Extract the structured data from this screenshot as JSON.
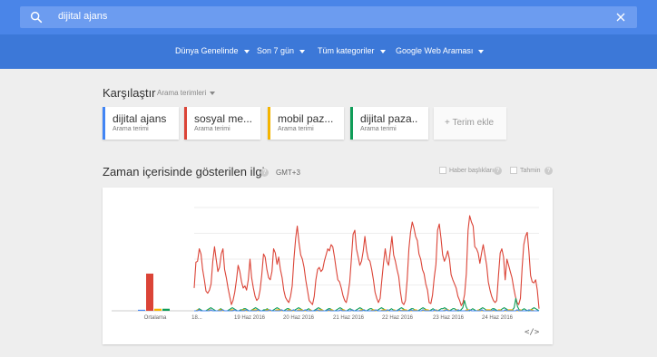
{
  "search": {
    "query": "dijital ajans"
  },
  "filters": [
    {
      "label": "Dünya Genelinde"
    },
    {
      "label": "Son 7 gün"
    },
    {
      "label": "Tüm kategoriler"
    },
    {
      "label": "Google Web Araması"
    }
  ],
  "compare": {
    "title": "Karşılaştır",
    "subtitle": "Arama terimleri",
    "terms": [
      {
        "name": "dijital ajans",
        "type": "Arama terimi",
        "color": "#4285f4"
      },
      {
        "name": "sosyal me...",
        "type": "Arama terimi",
        "color": "#db4437"
      },
      {
        "name": "mobil paz...",
        "type": "Arama terimi",
        "color": "#f4b400"
      },
      {
        "name": "dijital paza..",
        "type": "Arama terimi",
        "color": "#0f9d58"
      }
    ],
    "add_label": "+ Terim ekle"
  },
  "section": {
    "title": "Zaman içerisinde gösterilen ilgi",
    "timezone": "GMT+3",
    "news_label": "Haber başlıkları",
    "forecast_label": "Tahmin"
  },
  "chart_data": {
    "type": "line",
    "average_label": "Ortalama",
    "average_bars": [
      {
        "name": "dijital ajans",
        "value": 1
      },
      {
        "name": "sosyal medya",
        "value": 36
      },
      {
        "name": "mobil pazarlama",
        "value": 2
      },
      {
        "name": "dijital pazarlama",
        "value": 2
      }
    ],
    "x_ticks": [
      "18...",
      "19 Haz 2016",
      "20 Haz 2016",
      "21 Haz 2016",
      "22 Haz 2016",
      "23 Haz 2016",
      "24 Haz 2016"
    ],
    "ylim": [
      0,
      100
    ],
    "series": [
      {
        "name": "sosyal medya",
        "color": "#db4437",
        "values": [
          22,
          47,
          48,
          60,
          55,
          40,
          30,
          19,
          17,
          20,
          26,
          48,
          62,
          50,
          38,
          42,
          55,
          60,
          40,
          32,
          22,
          14,
          6,
          10,
          18,
          30,
          44,
          38,
          28,
          22,
          24,
          20,
          30,
          50,
          32,
          22,
          14,
          10,
          12,
          20,
          35,
          55,
          52,
          40,
          32,
          30,
          38,
          60,
          56,
          45,
          52,
          40,
          32,
          20,
          13,
          10,
          8,
          14,
          24,
          50,
          70,
          82,
          66,
          54,
          50,
          42,
          30,
          20,
          10,
          8,
          6,
          14,
          30,
          40,
          42,
          38,
          40,
          48,
          54,
          60,
          58,
          64,
          62,
          52,
          40,
          30,
          28,
          22,
          15,
          10,
          8,
          16,
          28,
          50,
          74,
          78,
          60,
          52,
          44,
          48,
          58,
          72,
          58,
          50,
          48,
          40,
          30,
          18,
          12,
          8,
          12,
          30,
          46,
          60,
          48,
          44,
          58,
          72,
          54,
          48,
          40,
          33,
          18,
          8,
          6,
          10,
          30,
          60,
          76,
          86,
          80,
          72,
          68,
          55,
          50,
          40,
          36,
          26,
          20,
          8,
          7,
          15,
          32,
          45,
          78,
          84,
          70,
          54,
          48,
          52,
          58,
          50,
          35,
          30,
          26,
          22,
          14,
          10,
          5,
          8,
          16,
          36,
          78,
          92,
          86,
          82,
          62,
          60,
          56,
          46,
          56,
          64,
          54,
          44,
          28,
          20,
          14,
          10,
          8,
          10,
          34,
          56,
          60,
          52,
          30,
          50,
          44,
          38,
          32,
          22,
          14,
          8,
          6,
          12,
          42,
          64,
          72,
          76,
          58,
          34,
          28,
          27,
          30,
          20,
          2
        ]
      },
      {
        "name": "dijital pazarlama",
        "color": "#0f9d58",
        "values": [
          0,
          0,
          1,
          2,
          1,
          0,
          0,
          0,
          1,
          2,
          3,
          2,
          1,
          0,
          0,
          1,
          2,
          1,
          0,
          0,
          0,
          1,
          2,
          3,
          2,
          1,
          0,
          0,
          1,
          1,
          2,
          2,
          1,
          0,
          0,
          1,
          2,
          3,
          2,
          1,
          0,
          0,
          1,
          1,
          2,
          1,
          0,
          0,
          1,
          2,
          3,
          2,
          1,
          0,
          0,
          1,
          2,
          2,
          1,
          0,
          0,
          1,
          2,
          3,
          2,
          1,
          0,
          0,
          1,
          2,
          1,
          0,
          0,
          1,
          2,
          3,
          2,
          1,
          0,
          0,
          1,
          2,
          2,
          1,
          0,
          0,
          1,
          2,
          3,
          2,
          1,
          0,
          0,
          1,
          2,
          1,
          0,
          0,
          1,
          2,
          3,
          2,
          1,
          0,
          0,
          1,
          2,
          2,
          1,
          0,
          0,
          1,
          2,
          3,
          2,
          1,
          0,
          0,
          1,
          2,
          1,
          0,
          0,
          1,
          2,
          3,
          2,
          1,
          0,
          0,
          1,
          2,
          2,
          1,
          0,
          0,
          1,
          2,
          3,
          2,
          1,
          0,
          0,
          1,
          2,
          1,
          0,
          0,
          1,
          2,
          2,
          3,
          2,
          1,
          0,
          1,
          2,
          2,
          1,
          0,
          0,
          1,
          3,
          10,
          4,
          1,
          0,
          1,
          2,
          1,
          0,
          0,
          1,
          2,
          3,
          2,
          1,
          0,
          0,
          1,
          2,
          2,
          1,
          0,
          0,
          1,
          2,
          3,
          2,
          1,
          0,
          0,
          1,
          3,
          12,
          4,
          1,
          0,
          1,
          2,
          1,
          0,
          0,
          1,
          2,
          3,
          2,
          1,
          0
        ]
      },
      {
        "name": "mobil pazarlama",
        "color": "#f4b400",
        "values": [
          0,
          0,
          1,
          1,
          0,
          0,
          0,
          0,
          0,
          1,
          1,
          0,
          0,
          0,
          0,
          1,
          1,
          0,
          0,
          0,
          0,
          0,
          1,
          1,
          1,
          0,
          0,
          0,
          0,
          1,
          1,
          0,
          0,
          0,
          0,
          1,
          1,
          1,
          0,
          0,
          0,
          0,
          0,
          1,
          1,
          0,
          0,
          0,
          0,
          1,
          1,
          1,
          0,
          0,
          0,
          0,
          1,
          1,
          0,
          0,
          0,
          0,
          1,
          1,
          1,
          0,
          0,
          0,
          0,
          1,
          0,
          0,
          0,
          0,
          1,
          1,
          1,
          0,
          0,
          0,
          0,
          1,
          1,
          0,
          0,
          0,
          0,
          1,
          1,
          1,
          0,
          0,
          0,
          0,
          1,
          0,
          0,
          0,
          0,
          1,
          1,
          1,
          0,
          0,
          0,
          0,
          1,
          1,
          0,
          0,
          0,
          0,
          1,
          1,
          1,
          0,
          0,
          0,
          0,
          1,
          0,
          0,
          0,
          0,
          1,
          1,
          1,
          0,
          0,
          0,
          0,
          1,
          1,
          0,
          0,
          0,
          0,
          1,
          1,
          1,
          0,
          0,
          0,
          0,
          1,
          0,
          0,
          0,
          0,
          1,
          1,
          1,
          0,
          0,
          0,
          0,
          1,
          1,
          0,
          0,
          0,
          0,
          1,
          1,
          1,
          0,
          0,
          0,
          0,
          1,
          0,
          0,
          0,
          0,
          1,
          1,
          1,
          0,
          0,
          0,
          0,
          1,
          1,
          0,
          0,
          0,
          0,
          1,
          1,
          1,
          0,
          0,
          0,
          0,
          1,
          0,
          0,
          0,
          0,
          1,
          1,
          1,
          0,
          0,
          0,
          0
        ]
      },
      {
        "name": "dijital ajans",
        "color": "#4285f4",
        "values": [
          0,
          0,
          0,
          1,
          0,
          0,
          0,
          0,
          0,
          0,
          1,
          0,
          0,
          0,
          0,
          0,
          0,
          1,
          0,
          0,
          0,
          0,
          0,
          0,
          1,
          0,
          0,
          0,
          0,
          0,
          0,
          1,
          0,
          0,
          0,
          0,
          0,
          0,
          1,
          0,
          0,
          0,
          0,
          0,
          0,
          1,
          0,
          0,
          0,
          0,
          0,
          0,
          1,
          0,
          0,
          0,
          0,
          0,
          0,
          1,
          0,
          0,
          0,
          0,
          0,
          0,
          1,
          0,
          0,
          0,
          0,
          0,
          0,
          1,
          0,
          0,
          0,
          0,
          0,
          0,
          1,
          0,
          0,
          0,
          0,
          0,
          0,
          1,
          0,
          0,
          0,
          0,
          0,
          0,
          1,
          0,
          0,
          0,
          0,
          0,
          0,
          1,
          0,
          0,
          0,
          0,
          0,
          0,
          1,
          0,
          0,
          0,
          0,
          0,
          0,
          1,
          0,
          0,
          0,
          0,
          0,
          0,
          1,
          0,
          0,
          0,
          0,
          0,
          0,
          1,
          0,
          0,
          0,
          0,
          0,
          0,
          1,
          0,
          0,
          0,
          0,
          0,
          0,
          1,
          0,
          0,
          0,
          0,
          0,
          0,
          1,
          0,
          0,
          0,
          0,
          0,
          0,
          1,
          0,
          0,
          0,
          0,
          0,
          0,
          1,
          0,
          0,
          0,
          0,
          0,
          0,
          1,
          0,
          0,
          0,
          0,
          0,
          0,
          1,
          0,
          0,
          0,
          0,
          0,
          0,
          1,
          0,
          0,
          0,
          0,
          0,
          0,
          1,
          0,
          0,
          0,
          0,
          0,
          0,
          1,
          0,
          0,
          0,
          0,
          0,
          0
        ]
      }
    ],
    "embed_label": "</>"
  }
}
